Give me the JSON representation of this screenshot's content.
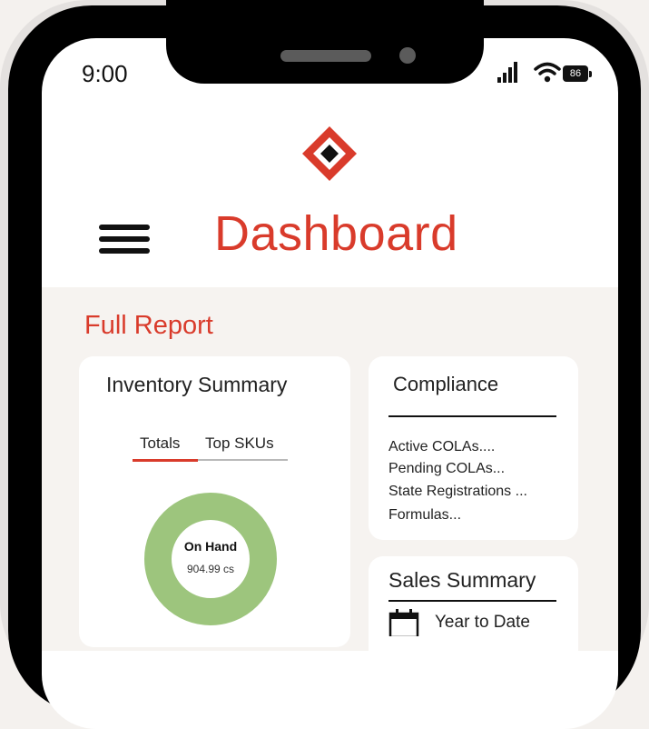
{
  "status_bar": {
    "time": "9:00",
    "battery": "86"
  },
  "header": {
    "title": "Dashboard"
  },
  "main": {
    "section_title": "Full Report",
    "inventory": {
      "title": "Inventory Summary",
      "tabs": [
        {
          "label": "Totals",
          "active": true
        },
        {
          "label": "Top SKUs",
          "active": false
        }
      ],
      "donut_label": "On Hand",
      "donut_value": "904.99 cs"
    },
    "compliance": {
      "title": "Compliance",
      "items": [
        "Active COLAs....",
        "Pending COLAs...",
        "State Registrations ...",
        "Formulas..."
      ]
    },
    "sales": {
      "title": "Sales Summary",
      "items": [
        {
          "label": "Year to Date",
          "icon": "calendar-icon"
        }
      ]
    }
  },
  "colors": {
    "accent": "#d93b2b",
    "donut": "#9dc57d",
    "background": "#f6f3f0"
  }
}
